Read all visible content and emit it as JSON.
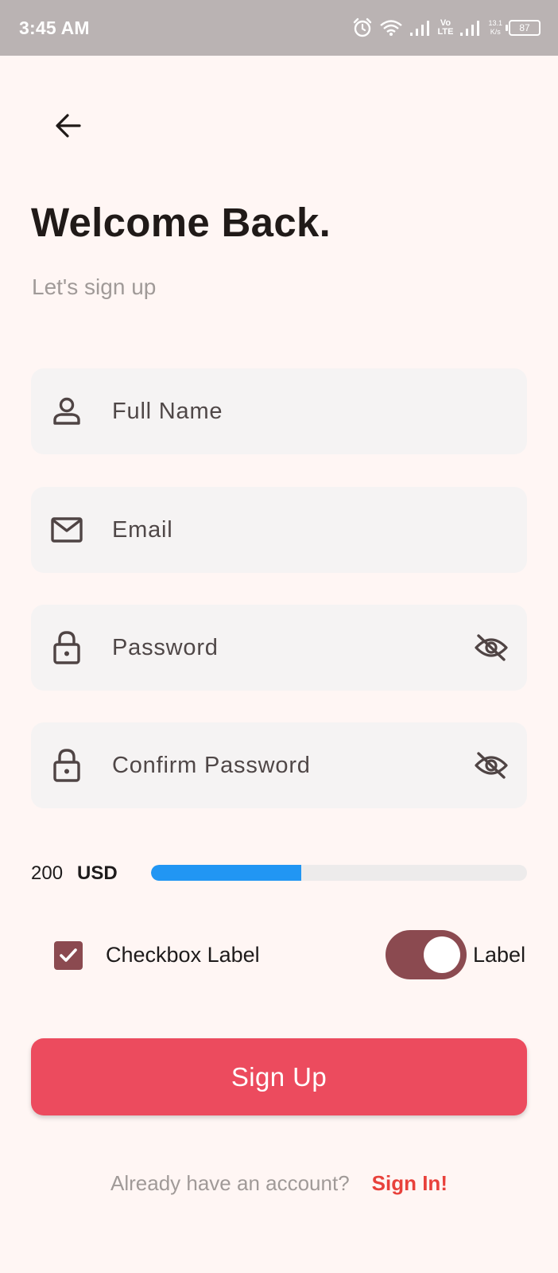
{
  "status_bar": {
    "time": "3:45 AM",
    "vo_lte_top": "Vo",
    "vo_lte_bottom": "LTE",
    "speed_value": "13.1",
    "speed_unit": "K/s",
    "battery": "87"
  },
  "header": {
    "back_icon": "arrow-left-icon",
    "title": "Welcome Back.",
    "subtitle": "Let's sign up"
  },
  "form": {
    "full_name": {
      "placeholder": "Full Name",
      "value": "",
      "icon": "person-icon"
    },
    "email": {
      "placeholder": "Email",
      "value": "",
      "icon": "mail-icon"
    },
    "password": {
      "placeholder": "Password",
      "value": "",
      "icon": "lock-icon",
      "toggle_icon": "eye-off-icon"
    },
    "confirm_password": {
      "placeholder": "Confirm Password",
      "value": "",
      "icon": "lock-icon",
      "toggle_icon": "eye-off-icon"
    }
  },
  "progress": {
    "amount": "200",
    "currency": "USD",
    "fraction": 0.4,
    "fill_color": "#2196F3"
  },
  "options": {
    "checkbox_label": "Checkbox Label",
    "checkbox_checked": true,
    "switch_label": "Label",
    "switch_on": true
  },
  "actions": {
    "signup_label": "Sign Up",
    "signup_color": "#EC4B5E"
  },
  "footer": {
    "question": "Already have an account?",
    "signin_label": "Sign In!"
  },
  "colors": {
    "background": "#FFF6F4",
    "accent": "#8B4A50",
    "link": "#E8413B"
  }
}
